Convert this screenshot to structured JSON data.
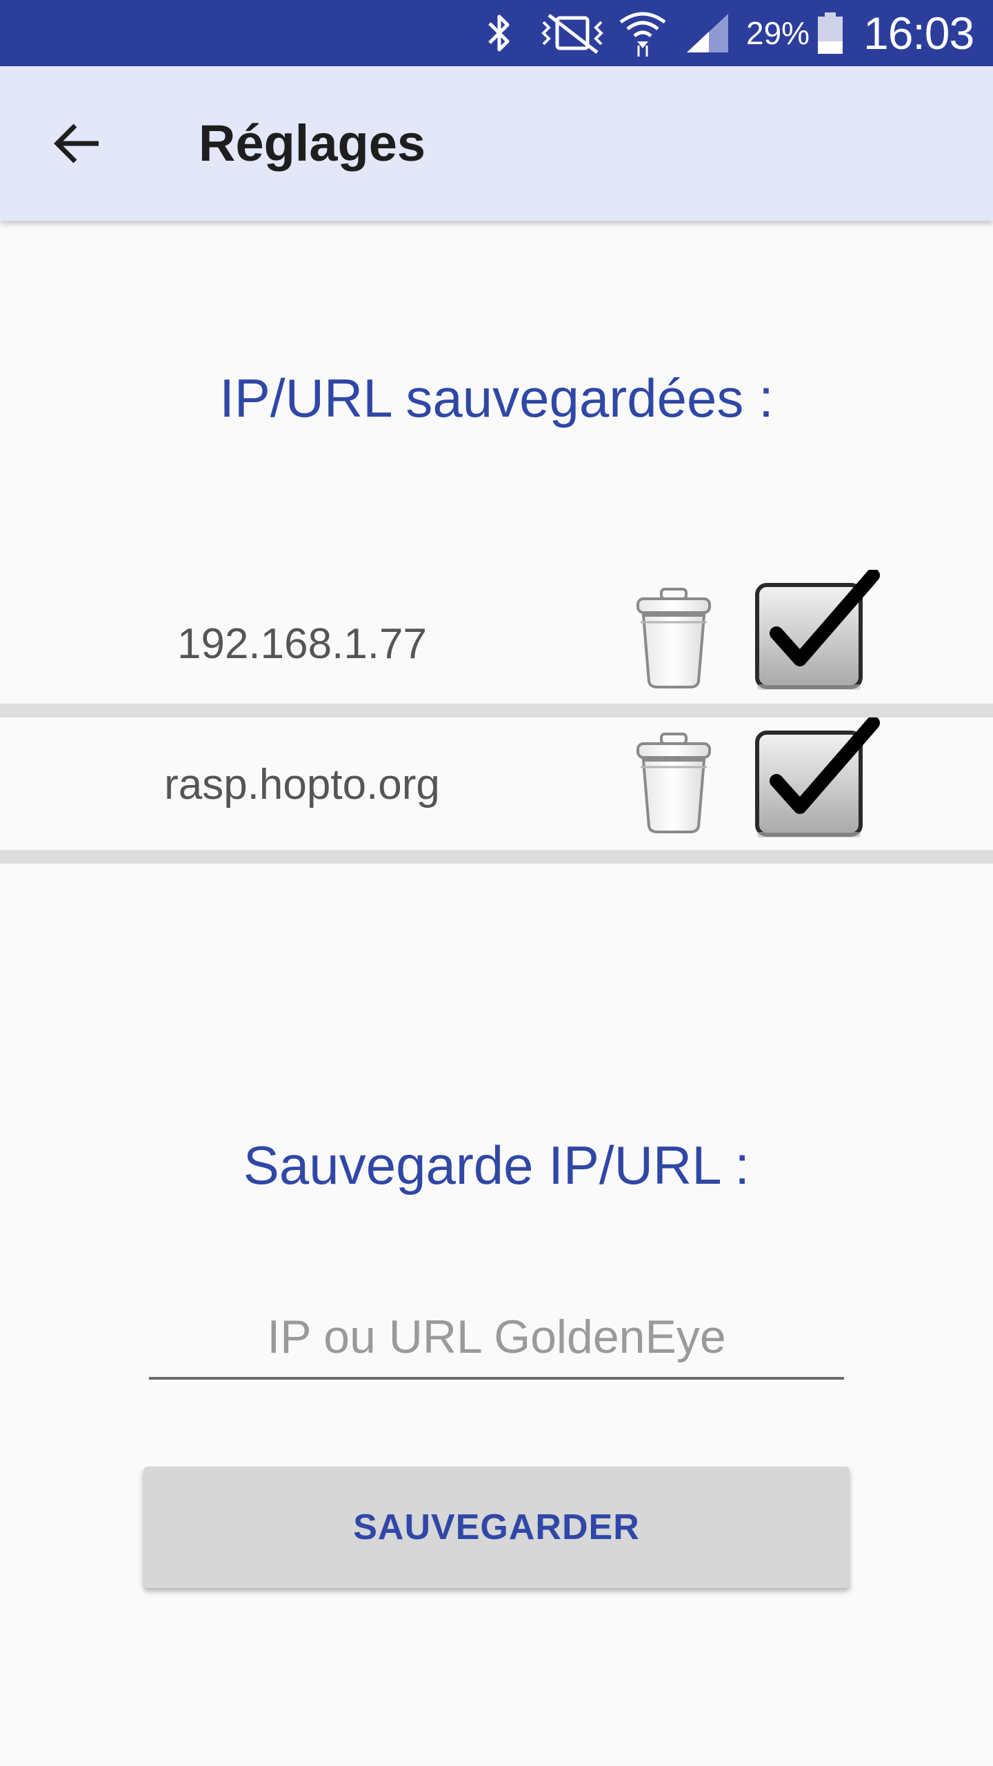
{
  "status_bar": {
    "icons": [
      "bluetooth-icon",
      "vibrate-mute-icon",
      "wifi-icon",
      "signal-icon",
      "battery-icon"
    ],
    "battery_percent": "29%",
    "time": "16:03"
  },
  "app_bar": {
    "back_icon": "arrow-back-icon",
    "title": "Réglages"
  },
  "saved_section": {
    "title": "IP/URL sauvegardées :",
    "items": [
      {
        "label": "192.168.1.77",
        "checked": true,
        "delete_icon": "trash-icon",
        "check_icon": "checkbox-checked-icon"
      },
      {
        "label": "rasp.hopto.org",
        "checked": true,
        "delete_icon": "trash-icon",
        "check_icon": "checkbox-checked-icon"
      }
    ]
  },
  "new_section": {
    "title": "Sauvegarde IP/URL :",
    "input_value": "",
    "input_placeholder": "IP ou URL GoldenEye",
    "save_label": "SAUVEGARDER"
  },
  "colors": {
    "status_bar": "#2c3e9c",
    "app_bar": "#e3e7f8",
    "accent": "#2f47a5",
    "button_bg": "#d6d7d6",
    "divider": "#dddddd"
  }
}
